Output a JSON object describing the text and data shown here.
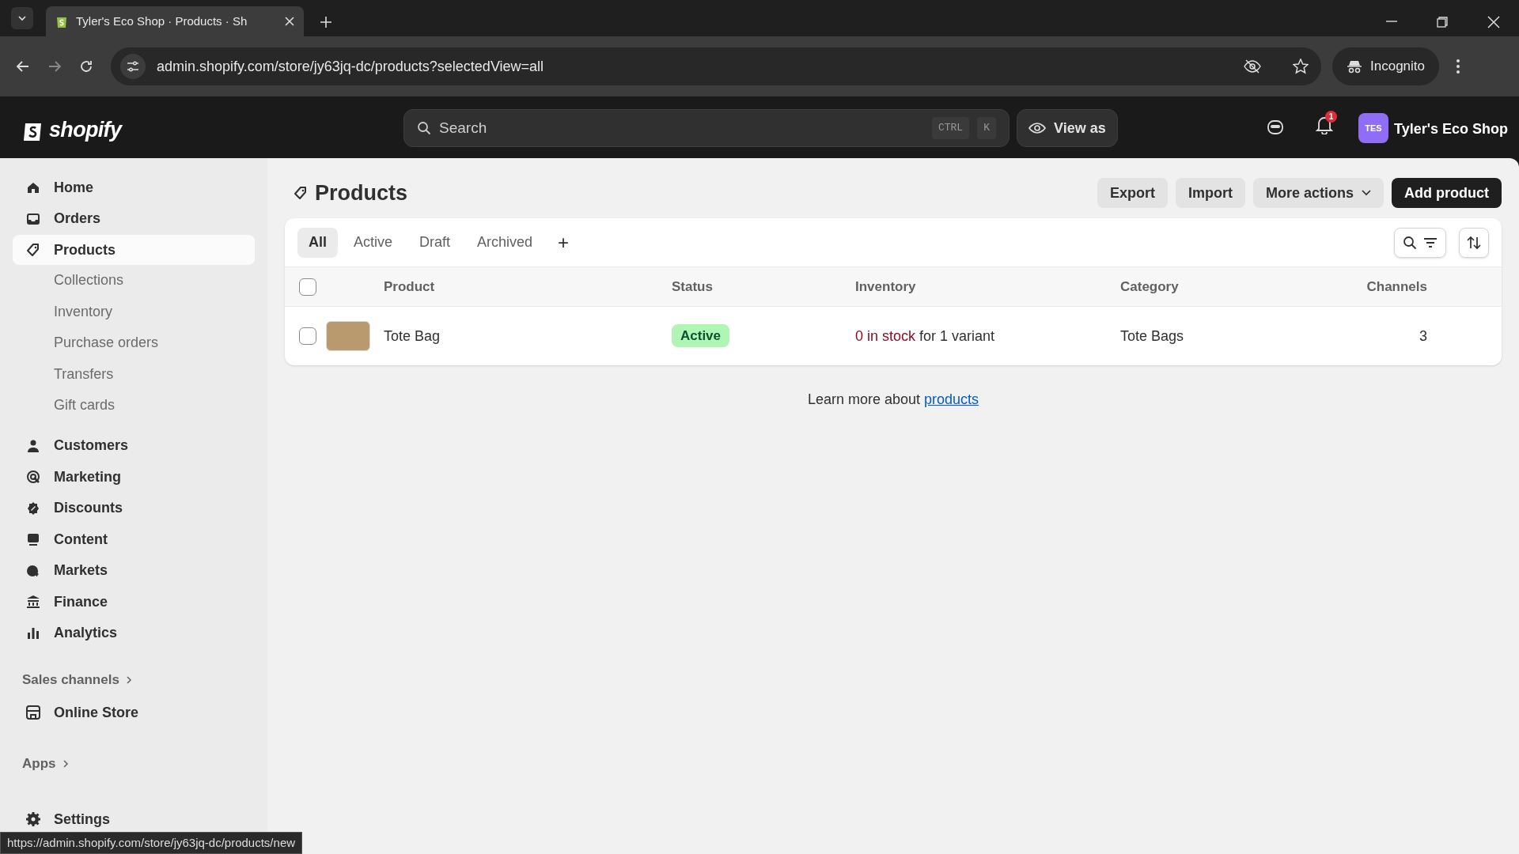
{
  "browser": {
    "tab_title": "Tyler's Eco Shop · Products · Sh",
    "url": "admin.shopify.com/store/jy63jq-dc/products?selectedView=all",
    "profile": "Incognito"
  },
  "topbar": {
    "logo": "shopify",
    "search": {
      "placeholder": "Search",
      "shortcut": [
        "CTRL",
        "K"
      ]
    },
    "view_as": "View as",
    "notification_count": "1",
    "store_initials": "TES",
    "store_name": "Tyler's Eco Shop"
  },
  "sidebar": {
    "items": [
      {
        "label": "Home",
        "selected": false
      },
      {
        "label": "Orders",
        "selected": false
      },
      {
        "label": "Products",
        "selected": true,
        "children": [
          {
            "label": "Collections"
          },
          {
            "label": "Inventory"
          },
          {
            "label": "Purchase orders"
          },
          {
            "label": "Transfers"
          },
          {
            "label": "Gift cards"
          }
        ]
      },
      {
        "label": "Customers",
        "selected": false
      },
      {
        "label": "Marketing",
        "selected": false
      },
      {
        "label": "Discounts",
        "selected": false
      },
      {
        "label": "Content",
        "selected": false
      },
      {
        "label": "Markets",
        "selected": false
      },
      {
        "label": "Finance",
        "selected": false
      },
      {
        "label": "Analytics",
        "selected": false
      }
    ],
    "sales_channels": {
      "heading": "Sales channels",
      "items": [
        {
          "label": "Online Store"
        }
      ]
    },
    "apps": {
      "heading": "Apps"
    },
    "settings": "Settings"
  },
  "page": {
    "title": "Products",
    "actions": [
      "Export",
      "Import",
      "More actions"
    ],
    "primary_action": "Add product",
    "views": [
      {
        "label": "All",
        "selected": true
      },
      {
        "label": "Active",
        "selected": false
      },
      {
        "label": "Draft",
        "selected": false
      },
      {
        "label": "Archived",
        "selected": false
      }
    ],
    "add_view": "+",
    "table": {
      "select_all_checked": false,
      "columns": [
        "Product",
        "Status",
        "Inventory",
        "Category",
        "Channels"
      ],
      "rows": [
        {
          "checked": false,
          "product": "Tote Bag",
          "status": "Active",
          "inventory_count": "0 in stock",
          "inventory_rest": "for 1 variant",
          "category": "Tote Bags",
          "channels": "3"
        }
      ]
    },
    "footer": {
      "text": "Learn more about",
      "link": "products"
    }
  },
  "status_url": "https://admin.shopify.com/store/jy63jq-dc/products/new"
}
